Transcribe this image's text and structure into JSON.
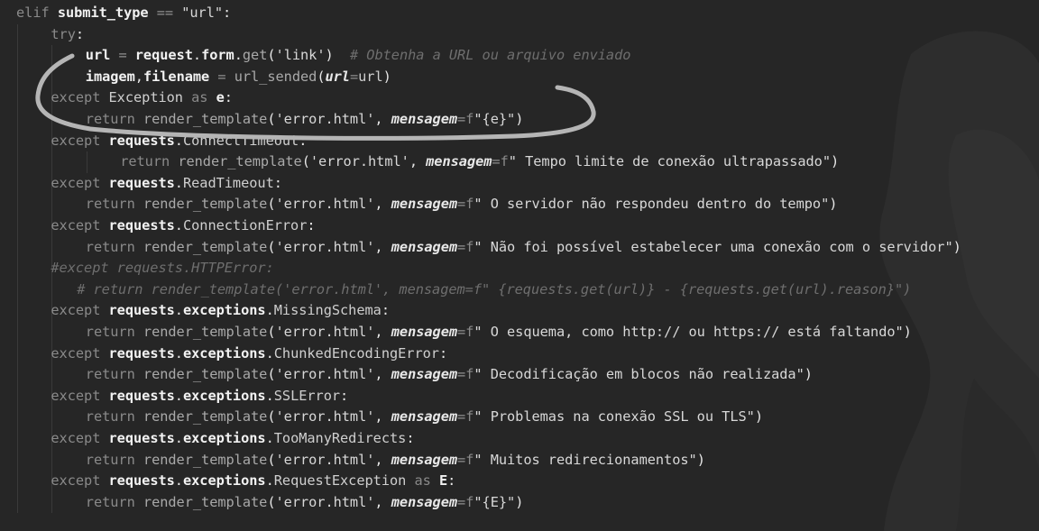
{
  "code_lines": [
    {
      "indent": 0,
      "tokens": [
        {
          "t": "elif ",
          "c": "kw"
        },
        {
          "t": "submit_type",
          "c": "bold"
        },
        {
          "t": " == ",
          "c": "op"
        },
        {
          "t": "\"url\"",
          "c": "str"
        },
        {
          "t": ":",
          "c": "punc"
        }
      ]
    },
    {
      "indent": 1,
      "tokens": [
        {
          "t": "try",
          "c": "kw"
        },
        {
          "t": ":",
          "c": "punc"
        }
      ]
    },
    {
      "indent": 2,
      "tokens": [
        {
          "t": "url",
          "c": "bold"
        },
        {
          "t": " = ",
          "c": "op"
        },
        {
          "t": "request",
          "c": "bold"
        },
        {
          "t": ".",
          "c": "punc"
        },
        {
          "t": "form",
          "c": "bold"
        },
        {
          "t": ".",
          "c": "punc"
        },
        {
          "t": "get",
          "c": "fn"
        },
        {
          "t": "(",
          "c": "punc"
        },
        {
          "t": "'link'",
          "c": "str"
        },
        {
          "t": ")  ",
          "c": "punc"
        },
        {
          "t": "# Obtenha a URL ou arquivo enviado",
          "c": "cmt"
        }
      ]
    },
    {
      "indent": 2,
      "tokens": [
        {
          "t": "imagem",
          "c": "bold"
        },
        {
          "t": ",",
          "c": "punc"
        },
        {
          "t": "filename",
          "c": "bold"
        },
        {
          "t": " = ",
          "c": "op"
        },
        {
          "t": "url_sended",
          "c": "fn"
        },
        {
          "t": "(",
          "c": "punc"
        },
        {
          "t": "url",
          "c": "param"
        },
        {
          "t": "=",
          "c": "op"
        },
        {
          "t": "url",
          "c": "def"
        },
        {
          "t": ")",
          "c": "punc"
        }
      ]
    },
    {
      "indent": 1,
      "tokens": [
        {
          "t": "except ",
          "c": "kw"
        },
        {
          "t": "Exception",
          "c": "def"
        },
        {
          "t": " as ",
          "c": "kw"
        },
        {
          "t": "e",
          "c": "bold"
        },
        {
          "t": ":",
          "c": "punc"
        }
      ]
    },
    {
      "indent": 2,
      "tokens": [
        {
          "t": "return ",
          "c": "kw"
        },
        {
          "t": "render_template",
          "c": "fn"
        },
        {
          "t": "(",
          "c": "punc"
        },
        {
          "t": "'error.html'",
          "c": "str"
        },
        {
          "t": ", ",
          "c": "punc"
        },
        {
          "t": "mensagem",
          "c": "param"
        },
        {
          "t": "=",
          "c": "op"
        },
        {
          "t": "f",
          "c": "kw"
        },
        {
          "t": "\"{e}\"",
          "c": "str"
        },
        {
          "t": ")",
          "c": "punc"
        }
      ]
    },
    {
      "indent": 1,
      "tokens": [
        {
          "t": "except ",
          "c": "kw"
        },
        {
          "t": "requests",
          "c": "bold"
        },
        {
          "t": ".",
          "c": "punc"
        },
        {
          "t": "ConnectTimeout",
          "c": "def"
        },
        {
          "t": ":",
          "c": "punc"
        }
      ]
    },
    {
      "indent": 3,
      "tokens": [
        {
          "t": "return ",
          "c": "kw"
        },
        {
          "t": "render_template",
          "c": "fn"
        },
        {
          "t": "(",
          "c": "punc"
        },
        {
          "t": "'error.html'",
          "c": "str"
        },
        {
          "t": ", ",
          "c": "punc"
        },
        {
          "t": "mensagem",
          "c": "param"
        },
        {
          "t": "=",
          "c": "op"
        },
        {
          "t": "f",
          "c": "kw"
        },
        {
          "t": "\" Tempo limite de conexão ultrapassado\"",
          "c": "str"
        },
        {
          "t": ")",
          "c": "punc"
        }
      ]
    },
    {
      "indent": 1,
      "tokens": [
        {
          "t": "except ",
          "c": "kw"
        },
        {
          "t": "requests",
          "c": "bold"
        },
        {
          "t": ".",
          "c": "punc"
        },
        {
          "t": "ReadTimeout",
          "c": "def"
        },
        {
          "t": ":",
          "c": "punc"
        }
      ]
    },
    {
      "indent": 2,
      "tokens": [
        {
          "t": "return ",
          "c": "kw"
        },
        {
          "t": "render_template",
          "c": "fn"
        },
        {
          "t": "(",
          "c": "punc"
        },
        {
          "t": "'error.html'",
          "c": "str"
        },
        {
          "t": ", ",
          "c": "punc"
        },
        {
          "t": "mensagem",
          "c": "param"
        },
        {
          "t": "=",
          "c": "op"
        },
        {
          "t": "f",
          "c": "kw"
        },
        {
          "t": "\" O servidor não respondeu dentro do tempo\"",
          "c": "str"
        },
        {
          "t": ")",
          "c": "punc"
        }
      ]
    },
    {
      "indent": 1,
      "tokens": [
        {
          "t": "except ",
          "c": "kw"
        },
        {
          "t": "requests",
          "c": "bold"
        },
        {
          "t": ".",
          "c": "punc"
        },
        {
          "t": "ConnectionError",
          "c": "def"
        },
        {
          "t": ":",
          "c": "punc"
        }
      ]
    },
    {
      "indent": 2,
      "tokens": [
        {
          "t": "return ",
          "c": "kw"
        },
        {
          "t": "render_template",
          "c": "fn"
        },
        {
          "t": "(",
          "c": "punc"
        },
        {
          "t": "'error.html'",
          "c": "str"
        },
        {
          "t": ", ",
          "c": "punc"
        },
        {
          "t": "mensagem",
          "c": "param"
        },
        {
          "t": "=",
          "c": "op"
        },
        {
          "t": "f",
          "c": "kw"
        },
        {
          "t": "\" Não foi possível estabelecer uma conexão com o servidor\"",
          "c": "str"
        },
        {
          "t": ")",
          "c": "punc"
        }
      ]
    },
    {
      "indent": 1,
      "tokens": [
        {
          "t": "#except requests.HTTPError:",
          "c": "cmt"
        }
      ]
    },
    {
      "indent": 1.75,
      "tokens": [
        {
          "t": "# return render_template('error.html', mensagem=f\" {requests.get(url)} - {requests.get(url).reason}\")",
          "c": "cmt"
        }
      ]
    },
    {
      "indent": 1,
      "tokens": [
        {
          "t": "except ",
          "c": "kw"
        },
        {
          "t": "requests",
          "c": "bold"
        },
        {
          "t": ".",
          "c": "punc"
        },
        {
          "t": "exceptions",
          "c": "bold"
        },
        {
          "t": ".",
          "c": "punc"
        },
        {
          "t": "MissingSchema",
          "c": "def"
        },
        {
          "t": ":",
          "c": "punc"
        }
      ]
    },
    {
      "indent": 2,
      "tokens": [
        {
          "t": "return ",
          "c": "kw"
        },
        {
          "t": "render_template",
          "c": "fn"
        },
        {
          "t": "(",
          "c": "punc"
        },
        {
          "t": "'error.html'",
          "c": "str"
        },
        {
          "t": ", ",
          "c": "punc"
        },
        {
          "t": "mensagem",
          "c": "param"
        },
        {
          "t": "=",
          "c": "op"
        },
        {
          "t": "f",
          "c": "kw"
        },
        {
          "t": "\" O esquema, como http:// ou https:// está faltando\"",
          "c": "str"
        },
        {
          "t": ")",
          "c": "punc"
        }
      ]
    },
    {
      "indent": 1,
      "tokens": [
        {
          "t": "except ",
          "c": "kw"
        },
        {
          "t": "requests",
          "c": "bold"
        },
        {
          "t": ".",
          "c": "punc"
        },
        {
          "t": "exceptions",
          "c": "bold"
        },
        {
          "t": ".",
          "c": "punc"
        },
        {
          "t": "ChunkedEncodingError",
          "c": "def"
        },
        {
          "t": ":",
          "c": "punc"
        }
      ]
    },
    {
      "indent": 2,
      "tokens": [
        {
          "t": "return ",
          "c": "kw"
        },
        {
          "t": "render_template",
          "c": "fn"
        },
        {
          "t": "(",
          "c": "punc"
        },
        {
          "t": "'error.html'",
          "c": "str"
        },
        {
          "t": ", ",
          "c": "punc"
        },
        {
          "t": "mensagem",
          "c": "param"
        },
        {
          "t": "=",
          "c": "op"
        },
        {
          "t": "f",
          "c": "kw"
        },
        {
          "t": "\" Decodificação em blocos não realizada\"",
          "c": "str"
        },
        {
          "t": ")",
          "c": "punc"
        }
      ]
    },
    {
      "indent": 1,
      "tokens": [
        {
          "t": "except ",
          "c": "kw"
        },
        {
          "t": "requests",
          "c": "bold"
        },
        {
          "t": ".",
          "c": "punc"
        },
        {
          "t": "exceptions",
          "c": "bold"
        },
        {
          "t": ".",
          "c": "punc"
        },
        {
          "t": "SSLError",
          "c": "def"
        },
        {
          "t": ":",
          "c": "punc"
        }
      ]
    },
    {
      "indent": 2,
      "tokens": [
        {
          "t": "return ",
          "c": "kw"
        },
        {
          "t": "render_template",
          "c": "fn"
        },
        {
          "t": "(",
          "c": "punc"
        },
        {
          "t": "'error.html'",
          "c": "str"
        },
        {
          "t": ", ",
          "c": "punc"
        },
        {
          "t": "mensagem",
          "c": "param"
        },
        {
          "t": "=",
          "c": "op"
        },
        {
          "t": "f",
          "c": "kw"
        },
        {
          "t": "\" Problemas na conexão SSL ou TLS\"",
          "c": "str"
        },
        {
          "t": ")",
          "c": "punc"
        }
      ]
    },
    {
      "indent": 1,
      "tokens": [
        {
          "t": "except ",
          "c": "kw"
        },
        {
          "t": "requests",
          "c": "bold"
        },
        {
          "t": ".",
          "c": "punc"
        },
        {
          "t": "exceptions",
          "c": "bold"
        },
        {
          "t": ".",
          "c": "punc"
        },
        {
          "t": "TooManyRedirects",
          "c": "def"
        },
        {
          "t": ":",
          "c": "punc"
        }
      ]
    },
    {
      "indent": 2,
      "tokens": [
        {
          "t": "return ",
          "c": "kw"
        },
        {
          "t": "render_template",
          "c": "fn"
        },
        {
          "t": "(",
          "c": "punc"
        },
        {
          "t": "'error.html'",
          "c": "str"
        },
        {
          "t": ", ",
          "c": "punc"
        },
        {
          "t": "mensagem",
          "c": "param"
        },
        {
          "t": "=",
          "c": "op"
        },
        {
          "t": "f",
          "c": "kw"
        },
        {
          "t": "\" Muitos redirecionamentos\"",
          "c": "str"
        },
        {
          "t": ")",
          "c": "punc"
        }
      ]
    },
    {
      "indent": 1,
      "tokens": [
        {
          "t": "except ",
          "c": "kw"
        },
        {
          "t": "requests",
          "c": "bold"
        },
        {
          "t": ".",
          "c": "punc"
        },
        {
          "t": "exceptions",
          "c": "bold"
        },
        {
          "t": ".",
          "c": "punc"
        },
        {
          "t": "RequestException",
          "c": "def"
        },
        {
          "t": " as ",
          "c": "kw"
        },
        {
          "t": "E",
          "c": "bold"
        },
        {
          "t": ":",
          "c": "punc"
        }
      ]
    },
    {
      "indent": 2,
      "tokens": [
        {
          "t": "return ",
          "c": "kw"
        },
        {
          "t": "render_template",
          "c": "fn"
        },
        {
          "t": "(",
          "c": "punc"
        },
        {
          "t": "'error.html'",
          "c": "str"
        },
        {
          "t": ", ",
          "c": "punc"
        },
        {
          "t": "mensagem",
          "c": "param"
        },
        {
          "t": "=",
          "c": "op"
        },
        {
          "t": "f",
          "c": "kw"
        },
        {
          "t": "\"{E}\"",
          "c": "str"
        },
        {
          "t": ")",
          "c": "punc"
        }
      ]
    }
  ],
  "colors": {
    "background": "#262626",
    "annotation_stroke": "#b5b5b5",
    "indent_guide": "#3a3a3a"
  }
}
